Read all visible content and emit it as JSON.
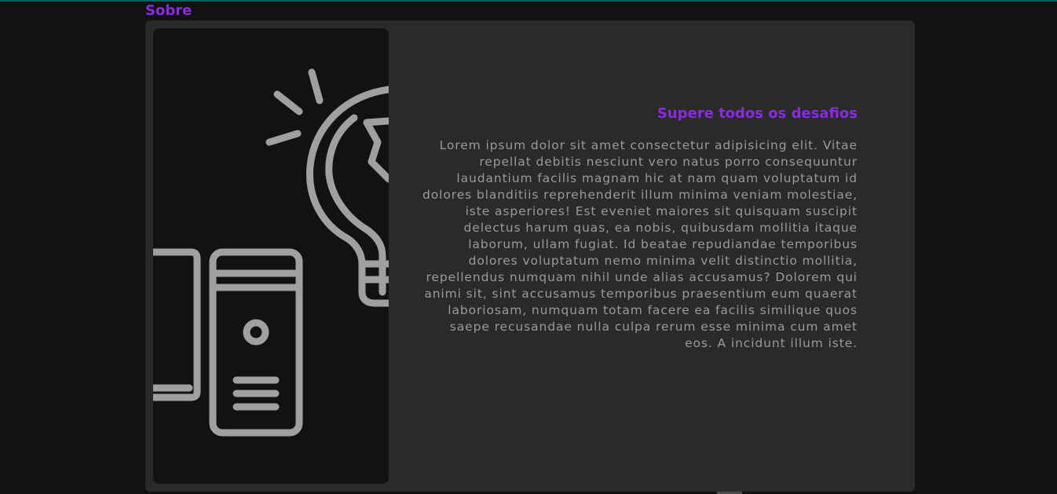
{
  "section": {
    "title": "Sobre"
  },
  "card": {
    "subtitle": "Supere todos os desafios",
    "body": "Lorem ipsum dolor sit amet consectetur adipisicing elit. Vitae repellat debitis nesciunt vero natus porro consequuntur laudantium facilis magnam hic at nam quam voluptatum id dolores blanditiis reprehenderit illum minima veniam molestiae, iste asperiores! Est eveniet maiores sit quisquam suscipit delectus harum quas, ea nobis, quibusdam mollitia itaque laborum, ullam fugiat. Id beatae repudiandae temporibus dolores voluptatum nemo minima velit distinctio mollitia, repellendus numquam nihil unde alias accusamus? Dolorem qui animi sit, sint accusamus temporibus praesentium eum quaerat laboriosam, numquam totam facere ea facilis similique quos saepe recusandae nulla culpa rerum esse minima cum amet eos. A incidunt illum iste.",
    "illustration": {
      "icons": [
        "lightbulb-icon",
        "computer-tower-icon",
        "monitor-icon"
      ],
      "stroke_color": "#a0a0a0",
      "background_color": "#121212"
    }
  },
  "colors": {
    "accent": "#8a2be2",
    "page_background": "#121212",
    "card_background": "#2a2a2a",
    "text": "#9a9a9a"
  }
}
